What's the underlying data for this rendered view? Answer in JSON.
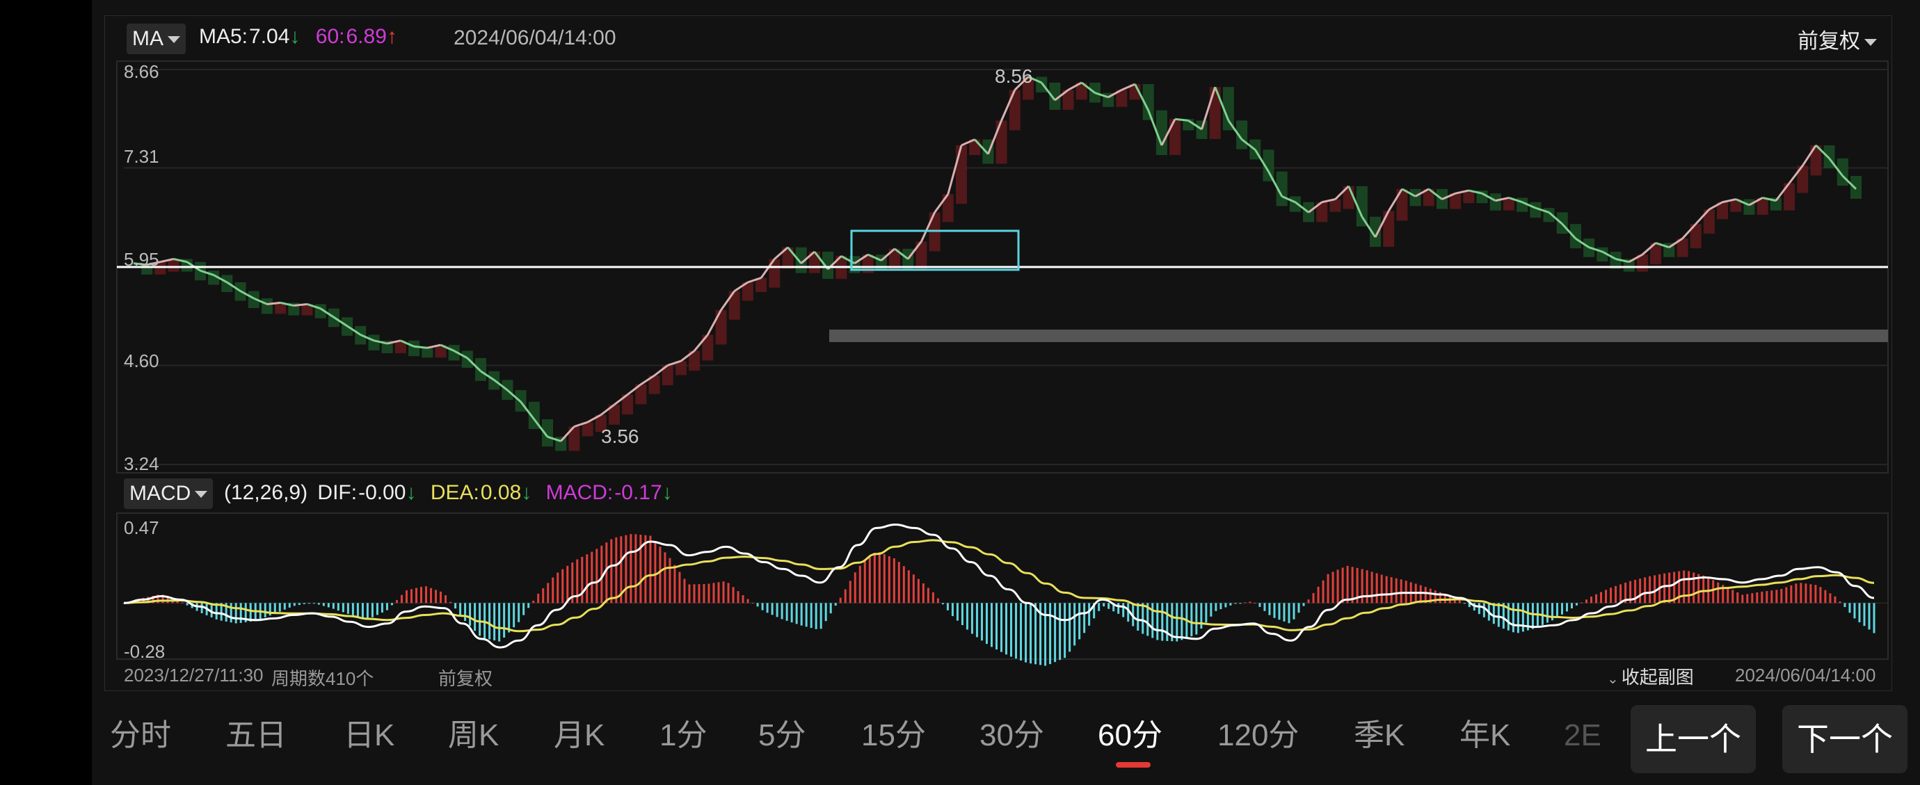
{
  "main_legend": {
    "indicator": "MA",
    "ma5_label": "MA5:",
    "ma5_value": "7.04",
    "ma5_arrow": "↓",
    "ma60_label": "60:",
    "ma60_value": "6.89",
    "ma60_arrow": "↑",
    "timestamp": "2024/06/04/14:00",
    "adjust": "前复权"
  },
  "price_axis": {
    "labels": [
      "8.66",
      "7.31",
      "5.95",
      "4.60",
      "3.24"
    ]
  },
  "price_markers": {
    "high": "8.56",
    "low": "3.56"
  },
  "macd_legend": {
    "indicator": "MACD",
    "params": "(12,26,9)",
    "dif_label": "DIF:",
    "dif_value": "-0.00",
    "dif_arrow": "↓",
    "dea_label": "DEA:",
    "dea_value": "0.08",
    "dea_arrow": "↓",
    "macd_label": "MACD:",
    "macd_value": "-0.17",
    "macd_arrow": "↓"
  },
  "macd_axis": {
    "labels": [
      "0.47",
      "-0.28"
    ]
  },
  "footer": {
    "start_time": "2023/12/27/11:30",
    "period_count": "周期数410个",
    "adjust": "前复权",
    "collapse": "收起副图",
    "end_time": "2024/06/04/14:00"
  },
  "tabs": [
    "分时",
    "五日",
    "日K",
    "周K",
    "月K",
    "1分",
    "5分",
    "15分",
    "30分",
    "60分",
    "120分",
    "季K",
    "年K",
    "2E"
  ],
  "active_tab": "60分",
  "nav": {
    "prev": "上一个",
    "next": "下一个"
  },
  "colors": {
    "up": "#e0403c",
    "down": "#2faa55",
    "ma60": "#d03bd8",
    "dif": "#ffffff",
    "dea": "#e8e05a",
    "macd_neg": "#5fd6e0",
    "box": "#5ad4de",
    "background": "#121212"
  },
  "chart_data": {
    "type": "line",
    "x_range": [
      "2023/12/27/11:30",
      "2024/06/04/14:00"
    ],
    "price": {
      "ylim": [
        3.24,
        8.66
      ],
      "reference_line": 5.95,
      "high": 8.56,
      "low": 3.56,
      "series": [
        6.0,
        5.98,
        6.02,
        6.06,
        6.02,
        5.9,
        5.84,
        5.74,
        5.62,
        5.52,
        5.44,
        5.46,
        5.42,
        5.44,
        5.38,
        5.26,
        5.14,
        5.02,
        4.94,
        4.9,
        4.94,
        4.86,
        4.84,
        4.88,
        4.8,
        4.7,
        4.52,
        4.4,
        4.26,
        4.1,
        3.86,
        3.62,
        3.56,
        3.76,
        3.82,
        3.92,
        4.06,
        4.2,
        4.34,
        4.46,
        4.6,
        4.66,
        4.8,
        5.02,
        5.36,
        5.62,
        5.74,
        5.8,
        6.06,
        6.22,
        6.0,
        6.16,
        5.92,
        6.1,
        6.0,
        6.12,
        6.04,
        6.2,
        6.06,
        6.3,
        6.7,
        6.95,
        7.62,
        7.7,
        7.5,
        7.96,
        8.38,
        8.56,
        8.48,
        8.24,
        8.38,
        8.48,
        8.34,
        8.28,
        8.38,
        8.46,
        8.1,
        7.62,
        7.98,
        7.96,
        7.84,
        8.42,
        7.96,
        7.7,
        7.56,
        7.26,
        6.92,
        6.84,
        6.7,
        6.84,
        6.88,
        7.06,
        6.64,
        6.36,
        6.72,
        7.02,
        6.92,
        7.02,
        6.88,
        6.96,
        7.0,
        6.96,
        6.86,
        6.9,
        6.84,
        6.76,
        6.7,
        6.54,
        6.34,
        6.22,
        6.16,
        6.06,
        6.02,
        6.12,
        6.28,
        6.22,
        6.34,
        6.54,
        6.74,
        6.84,
        6.88,
        6.8,
        6.9,
        6.86,
        7.1,
        7.34,
        7.62,
        7.44,
        7.2,
        7.02
      ]
    },
    "macd": {
      "ylim": [
        -0.28,
        0.47
      ],
      "dif": [
        0.0,
        0.02,
        0.04,
        0.02,
        -0.02,
        -0.06,
        -0.09,
        -0.1,
        -0.09,
        -0.07,
        -0.06,
        -0.08,
        -0.11,
        -0.14,
        -0.12,
        -0.05,
        -0.02,
        -0.03,
        -0.12,
        -0.21,
        -0.26,
        -0.22,
        -0.13,
        -0.04,
        0.04,
        0.12,
        0.22,
        0.3,
        0.36,
        0.34,
        0.28,
        0.3,
        0.33,
        0.29,
        0.24,
        0.2,
        0.16,
        0.12,
        0.21,
        0.34,
        0.44,
        0.46,
        0.44,
        0.4,
        0.32,
        0.24,
        0.16,
        0.08,
        0.0,
        -0.07,
        -0.1,
        -0.06,
        0.02,
        -0.02,
        -0.1,
        -0.16,
        -0.2,
        -0.21,
        -0.15,
        -0.13,
        -0.12,
        -0.18,
        -0.22,
        -0.14,
        -0.04,
        0.02,
        0.04,
        0.05,
        0.06,
        0.06,
        0.05,
        0.03,
        -0.02,
        -0.08,
        -0.13,
        -0.14,
        -0.13,
        -0.1,
        -0.06,
        -0.02,
        0.02,
        0.06,
        0.1,
        0.14,
        0.15,
        0.14,
        0.12,
        0.14,
        0.16,
        0.2,
        0.21,
        0.18,
        0.1,
        0.03
      ]
    },
    "dea_note": "",
    "macd_hist_note": ""
  }
}
